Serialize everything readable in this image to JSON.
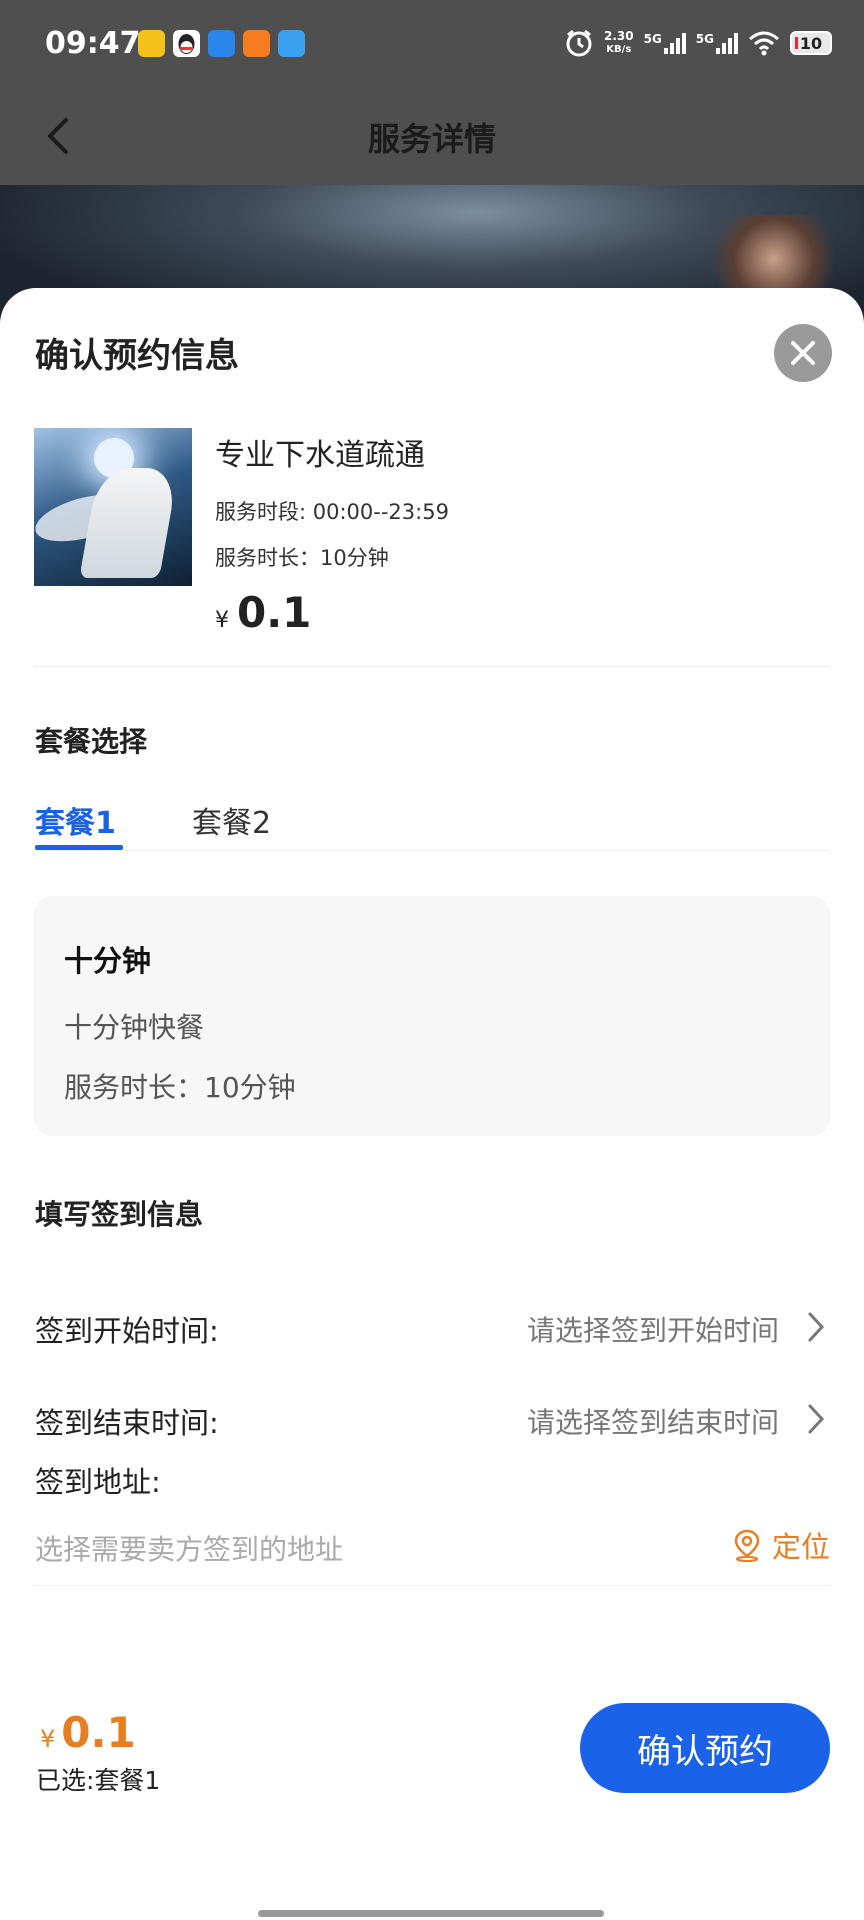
{
  "status_bar": {
    "time": "09:47",
    "net_speed_value": "2.30",
    "net_speed_unit": "KB/s",
    "sim1": "5G",
    "sim2": "5G",
    "battery": "10",
    "app_icon_colors": [
      "#f4c21a",
      "#222222",
      "#2a86e8",
      "#f57c1f",
      "#3aa0f0"
    ]
  },
  "navbar": {
    "title": "服务详情"
  },
  "sheet": {
    "title": "确认预约信息",
    "service": {
      "name": "专业下水道疏通",
      "time_slot": "服务时段: 00:00--23:59",
      "duration": "服务时长：10分钟",
      "currency": "¥",
      "price": "0.1"
    },
    "package_section": {
      "heading": "套餐选择",
      "tabs": [
        {
          "label": "套餐1",
          "active": true
        },
        {
          "label": "套餐2",
          "active": false
        }
      ],
      "card": {
        "title": "十分钟",
        "description": "十分钟快餐",
        "duration": "服务时长：10分钟"
      }
    },
    "checkin_section": {
      "heading": "填写签到信息",
      "start_label": "签到开始时间:",
      "start_placeholder": "请选择签到开始时间",
      "end_label": "签到结束时间:",
      "end_placeholder": "请选择签到结束时间",
      "address_label": "签到地址:",
      "address_placeholder": "选择需要卖方签到的地址",
      "locate_label": "定位"
    },
    "footer": {
      "currency": "¥",
      "total": "0.1",
      "selected": "已选:套餐1",
      "confirm_label": "确认预约"
    }
  },
  "colors": {
    "accent_blue": "#1a63e8",
    "accent_orange": "#e67e22"
  }
}
